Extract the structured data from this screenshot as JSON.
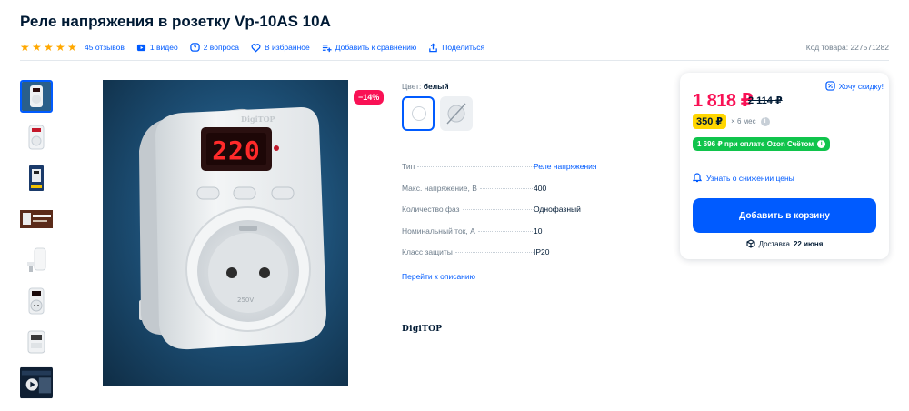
{
  "product": {
    "title": "Реле напряжения в розетку Vp-10AS 10А",
    "rating_stars": 5,
    "reviews": "45 отзывов",
    "video": "1 видео",
    "questions": "2 вопроса",
    "favorite": "В избранное",
    "compare": "Добавить к сравнению",
    "share": "Поделиться",
    "code": "Код товара: 227571282"
  },
  "gallery": {
    "discount_badge": "−14%",
    "screen_value": "220",
    "socket_rating": "250V"
  },
  "variant": {
    "color_label": "Цвет:",
    "color_value": "белый"
  },
  "specs": [
    {
      "name": "Тип",
      "value": "Реле напряжения",
      "link": true
    },
    {
      "name": "Макс. напряжение, В",
      "value": "400",
      "link": false
    },
    {
      "name": "Количество фаз",
      "value": "Однофазный",
      "link": false
    },
    {
      "name": "Номинальный ток, А",
      "value": "10",
      "link": false
    },
    {
      "name": "Класс защиты",
      "value": "IP20",
      "link": false
    }
  ],
  "description_link": "Перейти к описанию",
  "brand": "DigiTOP",
  "buybox": {
    "price": "1 818 ₽",
    "old_price": "2 114 ₽",
    "want_discount": "Хочу скидку!",
    "installment_price": "350 ₽",
    "installment_term": "× 6 мес",
    "card_offer": "1 696 ₽ при оплате Ozon Счётом",
    "notify": "Узнать о снижении цены",
    "add_to_cart": "Добавить в корзину",
    "delivery_label": "Доставка",
    "delivery_date": "22 июня"
  },
  "colors": {
    "accent": "#005bff",
    "price": "#f91155",
    "green": "#10c44c",
    "yellow": "#ffd600",
    "star": "#ffa800"
  }
}
